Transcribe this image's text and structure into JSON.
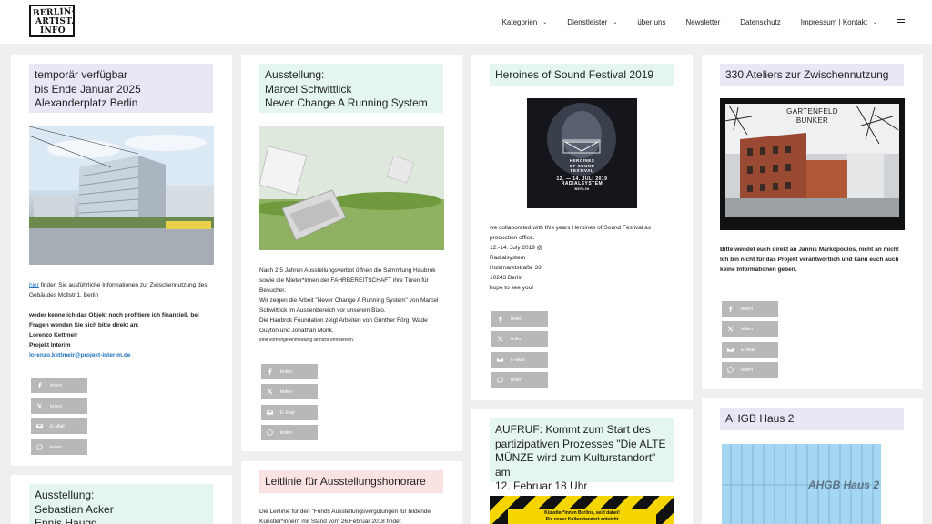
{
  "logo": {
    "line1": "BERLIN-",
    "line2": "ARTIST.",
    "line3": "INFO"
  },
  "nav": [
    {
      "label": "Kategorien",
      "dropdown": true
    },
    {
      "label": "Dienstleister",
      "dropdown": true
    },
    {
      "label": "über uns",
      "dropdown": false
    },
    {
      "label": "Newsletter",
      "dropdown": false
    },
    {
      "label": "Datenschutz",
      "dropdown": false
    },
    {
      "label": "Impressum | Kontakt",
      "dropdown": true
    }
  ],
  "share": {
    "facebook": "teilen",
    "x": "teilen",
    "email": "E-Mail",
    "whatsapp": "teilen"
  },
  "cards": {
    "c1": {
      "title": [
        "temporär verfügbar",
        "bis Ende Januar 2025",
        "Alexanderplatz Berlin"
      ],
      "link": "hier",
      "text1": " finden Sie ausführliche Informationen zur Zwischennutzung des Gebäudes Mollstr.1, Berlin",
      "bold": "weder kenne ich das Objekt noch profitiere ich finanziell, bei Fragen wenden Sie sich bitte direkt an:",
      "contact1": "Lorenzo Kettmeir",
      "contact2": "Projekt Interim",
      "email": "lorenzo.kettmeir@projekt-interim.de"
    },
    "c2": {
      "title": [
        "Ausstellung:",
        "Marcel Schwittlick",
        "Never Change A Running System"
      ],
      "p1": "Nach 2,5 Jahren Ausstellungsverbot öffnen die Sammlung Haubrok sowie die Mieter*innen der FAHRBEREITSCHAFT ihre Türen für Besucher.",
      "p2": "Wir zeigen die Arbeit \"Never Change A Running System\" von Marcel Schwittlick im Aussenbereich vor unserem Büro.",
      "p3": "Die Haubrok Foundation zeigt Arbeiten von Günther Förg, Wade Guyton und Jonathan Monk.",
      "p4": "eine vorherige Anmeldung ist nicht erforderlich."
    },
    "c3": {
      "title": "Heroines of Sound Festival 2019",
      "poster": {
        "title1": "HEROINES",
        "title2": "OF SOUND",
        "title3": "FESTIVAL",
        "date": "12. — 14. JULI 2019",
        "venue": "RADIALSYSTEM",
        "city": "BERLIN"
      },
      "lines": [
        "we collaborated with this years Heroines of Sound Festival as production office.",
        "12.-14. July 2019 @",
        "Radialsystem",
        "Holzmarktstraße 33",
        "10243 Berlin",
        "hope to see you!"
      ]
    },
    "c4": {
      "title": "330 Ateliers zur Zwischennutzung",
      "sign1": "GARTENFELD",
      "sign2": "BUNKER",
      "bold1": "Bitte wendet euch direkt an Jannis Markopoulos, nicht an mich!",
      "bold2": "Ich bin nicht für das Projekt verantwortlich und kann euch auch keine Informationen geben."
    },
    "c5": {
      "title": [
        "Ausstellung:",
        "Sebastian Acker",
        "Ennis Haugg"
      ]
    },
    "c6": {
      "title": "Leitlinie für Ausstellungshonorare",
      "text": "Die Leitlinie für den \"Fonds Ausstellungsvergütungen für bildende Künstler*innen\" mit Stand vom 26.Februar 2018 findet"
    },
    "c7": {
      "title": [
        "AUFRUF: Kommt zum Start des",
        "partizipativen Prozesses \"Die ALTE",
        "MÜNZE wird zum Kulturstandort\" am",
        "12. Februar 18 Uhr"
      ],
      "banner1": "Künstler*innen Berlins, seid dabei!",
      "banner2": "Die neuer Kulturstandort entsteht"
    },
    "c8": {
      "title": "AHGB Haus 2",
      "imgtext": "AHGB Haus 2"
    }
  }
}
